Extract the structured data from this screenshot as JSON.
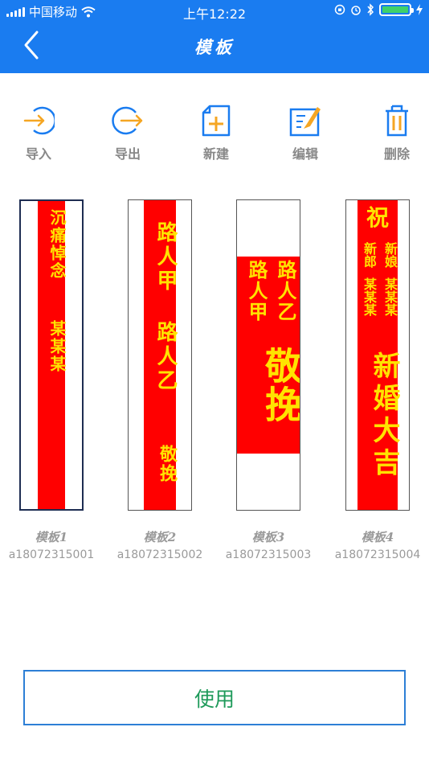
{
  "status_bar": {
    "carrier": "中国移动",
    "time": "上午12:22"
  },
  "nav": {
    "title": "模板",
    "back_icon": "chevron-left-icon"
  },
  "toolbar": [
    {
      "label": "导入",
      "icon": "import-icon"
    },
    {
      "label": "导出",
      "icon": "export-icon"
    },
    {
      "label": "新建",
      "icon": "new-file-icon"
    },
    {
      "label": "编辑",
      "icon": "edit-icon"
    },
    {
      "label": "删除",
      "icon": "trash-icon"
    }
  ],
  "templates": [
    {
      "name": "模板1",
      "code": "a18072315001",
      "selected": true,
      "text": {
        "line1": "沉痛悼念",
        "line2": "某某某"
      }
    },
    {
      "name": "模板2",
      "code": "a18072315002",
      "selected": false,
      "text": {
        "line1": "路人甲",
        "line2": "路人乙",
        "line3": "敬挽"
      }
    },
    {
      "name": "模板3",
      "code": "a18072315003",
      "selected": false,
      "text": {
        "col_right": "路人乙",
        "col_left": "路人甲",
        "big": "敬挽"
      }
    },
    {
      "name": "模板4",
      "code": "a18072315004",
      "selected": false,
      "text": {
        "top": "祝",
        "col_right1": "新娘",
        "col_right2": "某某某",
        "col_left1": "新郎",
        "col_left2": "某某某",
        "big": "新婚大吉"
      }
    }
  ],
  "use_button": {
    "label": "使用"
  },
  "colors": {
    "header_blue": "#1a7cf0",
    "banner_red": "#ff0000",
    "banner_text_yellow": "#ffe300",
    "icon_orange": "#f5a623",
    "icon_blue": "#1a7cf0",
    "button_text_green": "#1e9a5a"
  }
}
